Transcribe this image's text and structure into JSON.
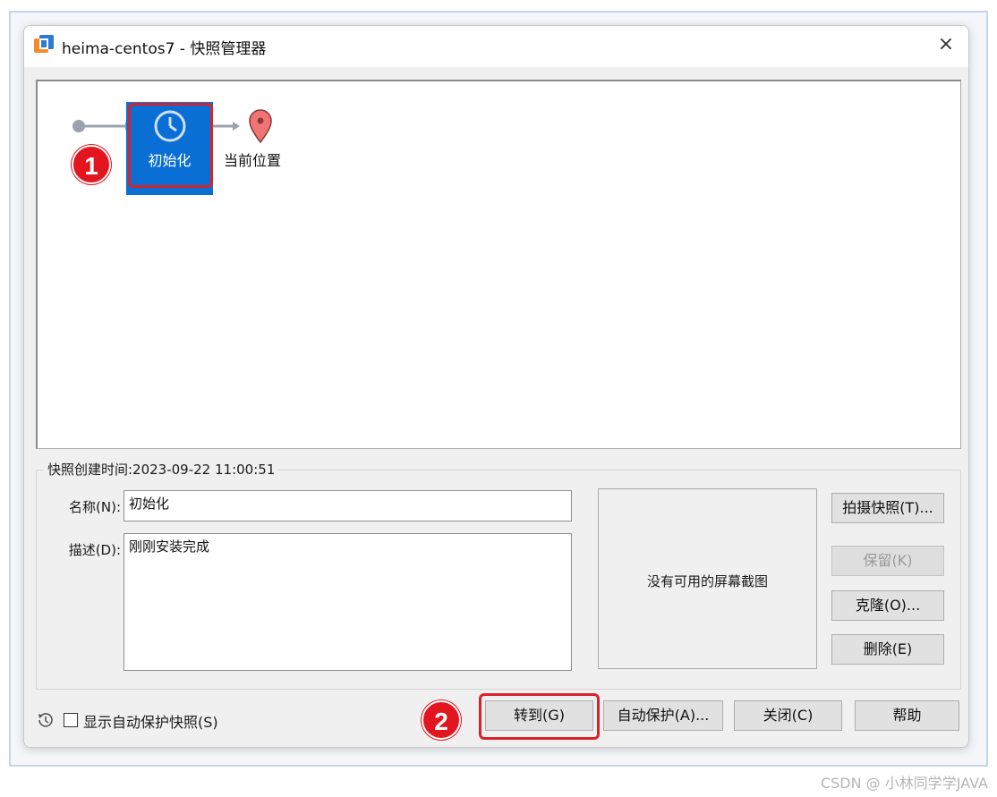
{
  "window": {
    "title": "heima-centos7 - 快照管理器",
    "close_glyph": "×"
  },
  "tree": {
    "snapshot_label": "初始化",
    "current_label": "当前位置"
  },
  "annotations": {
    "badge_1": "1",
    "badge_2": "2",
    "highlight_color": "#d8232a"
  },
  "details": {
    "legend": "快照创建时间:2023-09-22 11:00:51",
    "name_label": "名称(N):",
    "name_value": "初始化",
    "desc_label": "描述(D):",
    "desc_value": "刚刚安装完成",
    "screenshot_text": "没有可用的屏幕截图"
  },
  "side_buttons": {
    "take_snapshot": "拍摄快照(T)...",
    "keep": "保留(K)",
    "clone": "克隆(O)...",
    "delete": "删除(E)"
  },
  "footer": {
    "show_autoprotect": "显示自动保护快照(S)",
    "goto": "转到(G)",
    "autoprotect": "自动保护(A)...",
    "close": "关闭(C)",
    "help": "帮助"
  },
  "watermark": "CSDN @ 小林同学学JAVA",
  "colors": {
    "selection": "#0a6fd4",
    "badge": "#e3161f",
    "location_pin": "#f07474"
  }
}
